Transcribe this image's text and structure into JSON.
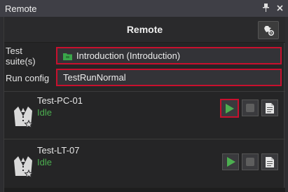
{
  "window": {
    "title": "Remote"
  },
  "header": {
    "title": "Remote"
  },
  "form": {
    "test_suites_label": "Test suite(s)",
    "test_suites_value": "Introduction (Introduction)",
    "run_config_label": "Run config",
    "run_config_value": "TestRunNormal"
  },
  "machines": [
    {
      "name": "Test-PC-01",
      "status": "Idle"
    },
    {
      "name": "Test-LT-07",
      "status": "Idle"
    }
  ],
  "colors": {
    "accent_red": "#c8102e",
    "status_green": "#4caf50",
    "play_green": "#4caf50"
  },
  "icons": [
    "pin-icon",
    "close-icon",
    "settings-icon",
    "folder-icon",
    "tester-avatar-icon",
    "play-icon",
    "stop-icon",
    "log-icon"
  ]
}
